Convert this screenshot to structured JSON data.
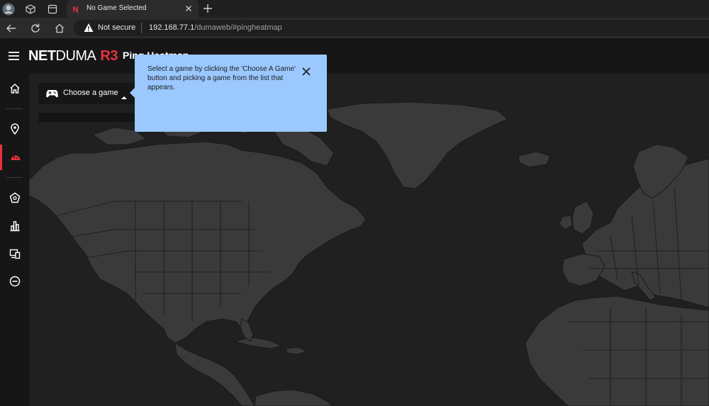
{
  "browser": {
    "tab_title": "No Game Selected",
    "security_label": "Not secure",
    "url_host": "192.168.77.1",
    "url_path": "/dumaweb/#pingheatmap"
  },
  "app": {
    "logo_bold": "NET",
    "logo_thin": "DUMA",
    "logo_model": "R3",
    "page_title": "Ping Heatmap",
    "accent_color": "#e8323c"
  },
  "sidebar": {
    "items": [
      {
        "icon": "home-icon"
      },
      {
        "icon": "location-pin-icon"
      },
      {
        "icon": "ping-heatmap-icon",
        "active": true
      },
      {
        "icon": "shield-icon"
      },
      {
        "icon": "bar-chart-icon"
      },
      {
        "icon": "devices-icon"
      },
      {
        "icon": "block-icon"
      }
    ]
  },
  "game_selector": {
    "label": "Choose a game"
  },
  "tooltip": {
    "text": "Select a game by clicking the 'Choose A Game' button and picking a game from the list that appears.",
    "background": "#9ac8ff"
  }
}
